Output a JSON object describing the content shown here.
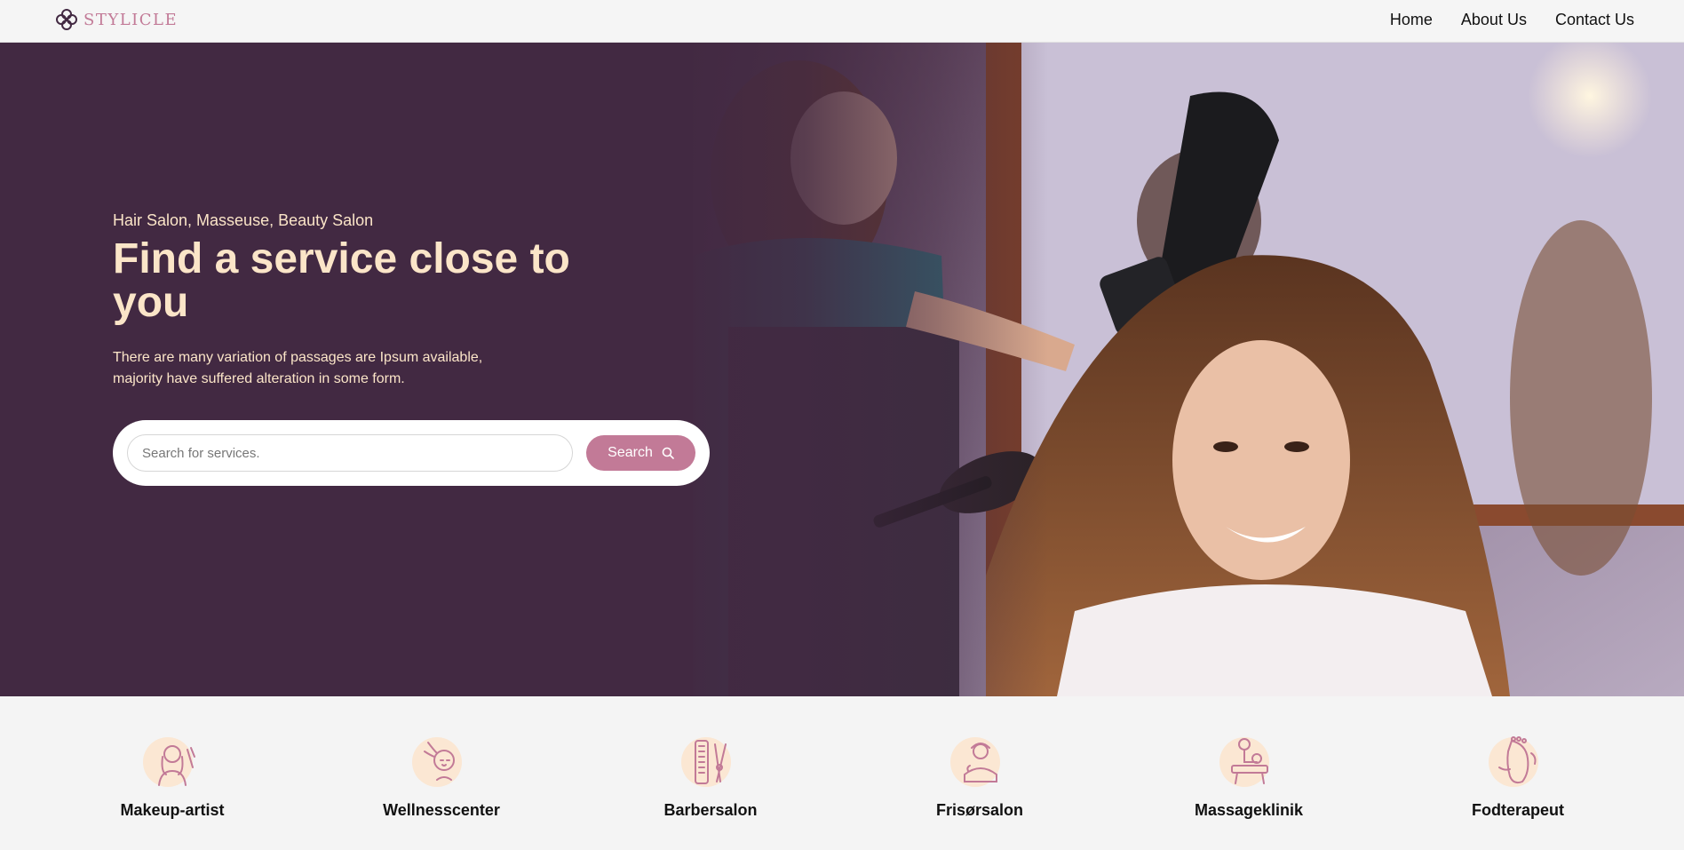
{
  "brand": {
    "name": "STYLICLE",
    "accent": "#c27a97",
    "hero_bg": "#422942",
    "text_cream": "#fbe5c8"
  },
  "nav": {
    "links": [
      "Home",
      "About Us",
      "Contact Us"
    ]
  },
  "hero": {
    "eyebrow": "Hair Salon, Masseuse, Beauty Salon",
    "title": "Find a service close to you",
    "description": "There are many variation of passages are Ipsum available, majority have suffered alteration in some form.",
    "search": {
      "placeholder": "Search for services.",
      "button_label": "Search",
      "button_icon": "search-icon"
    }
  },
  "categories": [
    {
      "label": "Makeup-artist",
      "icon": "makeup-artist-icon"
    },
    {
      "label": "Wellnesscenter",
      "icon": "wellness-icon"
    },
    {
      "label": "Barbersalon",
      "icon": "barber-icon"
    },
    {
      "label": "Frisørsalon",
      "icon": "hair-salon-icon"
    },
    {
      "label": "Massageklinik",
      "icon": "massage-icon"
    },
    {
      "label": "Fodterapeut",
      "icon": "foot-therapy-icon"
    }
  ]
}
